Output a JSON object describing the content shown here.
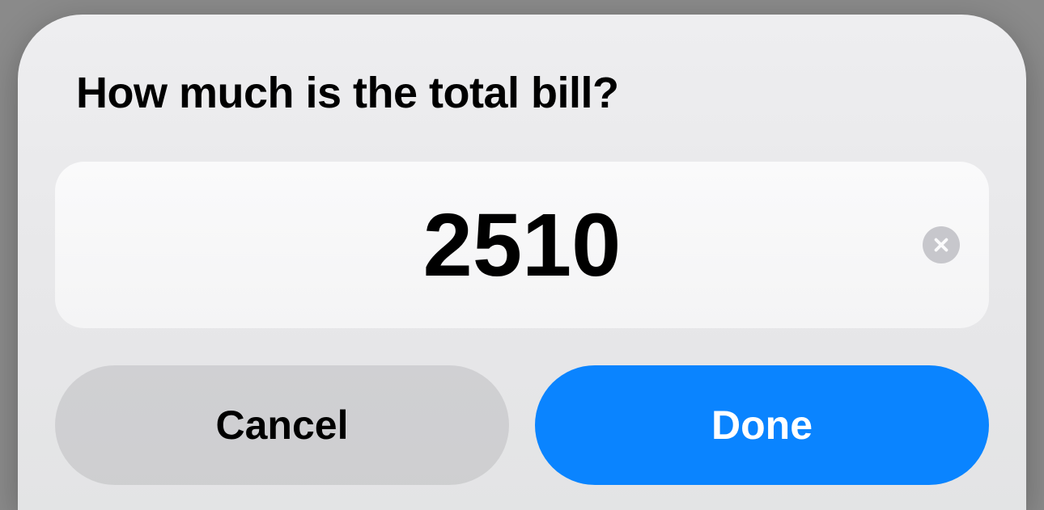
{
  "dialog": {
    "title": "How much is the total bill?",
    "input_value": "2510",
    "cancel_label": "Cancel",
    "done_label": "Done"
  }
}
